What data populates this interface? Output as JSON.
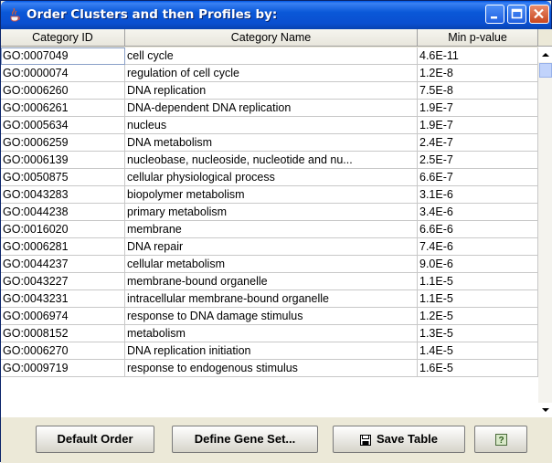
{
  "window": {
    "title": "Order Clusters and then Profiles by:",
    "icon": "java-cup-icon",
    "controls": [
      "minimize-icon",
      "maximize-icon",
      "close-icon"
    ]
  },
  "table": {
    "columns": [
      "Category ID",
      "Category Name",
      "Min p-value"
    ],
    "rows": [
      {
        "id": "GO:0007049",
        "name": "cell cycle",
        "p": "4.6E-11"
      },
      {
        "id": "GO:0000074",
        "name": "regulation of cell cycle",
        "p": "1.2E-8"
      },
      {
        "id": "GO:0006260",
        "name": "DNA replication",
        "p": "7.5E-8"
      },
      {
        "id": "GO:0006261",
        "name": "DNA-dependent DNA replication",
        "p": "1.9E-7"
      },
      {
        "id": "GO:0005634",
        "name": "nucleus",
        "p": "1.9E-7"
      },
      {
        "id": "GO:0006259",
        "name": "DNA metabolism",
        "p": "2.4E-7"
      },
      {
        "id": "GO:0006139",
        "name": "nucleobase, nucleoside, nucleotide and nu...",
        "p": "2.5E-7"
      },
      {
        "id": "GO:0050875",
        "name": "cellular physiological process",
        "p": "6.6E-7"
      },
      {
        "id": "GO:0043283",
        "name": "biopolymer metabolism",
        "p": "3.1E-6"
      },
      {
        "id": "GO:0044238",
        "name": "primary metabolism",
        "p": "3.4E-6"
      },
      {
        "id": "GO:0016020",
        "name": "membrane",
        "p": "6.6E-6"
      },
      {
        "id": "GO:0006281",
        "name": "DNA repair",
        "p": "7.4E-6"
      },
      {
        "id": "GO:0044237",
        "name": "cellular metabolism",
        "p": "9.0E-6"
      },
      {
        "id": "GO:0043227",
        "name": "membrane-bound organelle",
        "p": "1.1E-5"
      },
      {
        "id": "GO:0043231",
        "name": "intracellular membrane-bound organelle",
        "p": "1.1E-5"
      },
      {
        "id": "GO:0006974",
        "name": "response to DNA damage stimulus",
        "p": "1.2E-5"
      },
      {
        "id": "GO:0008152",
        "name": "metabolism",
        "p": "1.3E-5"
      },
      {
        "id": "GO:0006270",
        "name": "DNA replication initiation",
        "p": "1.4E-5"
      },
      {
        "id": "GO:0009719",
        "name": "response to endogenous stimulus",
        "p": "1.6E-5"
      }
    ],
    "selected_row": 0
  },
  "buttons": {
    "default_order": "Default Order",
    "define_gene_set": "Define Gene Set...",
    "save_table": "Save Table",
    "save_icon": "floppy-disk-icon",
    "help_icon": "help-icon"
  }
}
